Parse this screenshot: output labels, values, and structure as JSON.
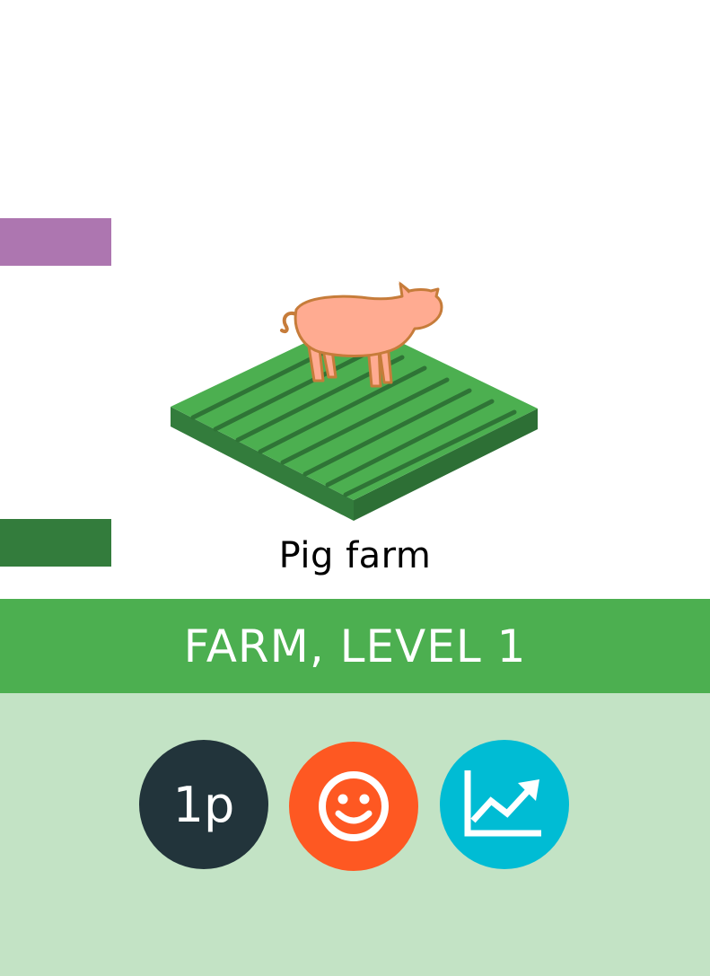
{
  "card": {
    "name": "Pig farm",
    "banner": "FARM, LEVEL 1",
    "badges": [
      {
        "label": "1p",
        "icon": "cost-badge",
        "color": "#22343b"
      },
      {
        "icon": "smiley-face-icon",
        "color": "#fe5822"
      },
      {
        "icon": "growth-chart-icon",
        "color": "#00bcd4"
      }
    ]
  },
  "colors": {
    "banner": "#4caf50",
    "panel": "#c3e3c5",
    "stripe_purple": "#ad76b0",
    "stripe_green": "#337c3c",
    "pig": "#ffab91"
  }
}
